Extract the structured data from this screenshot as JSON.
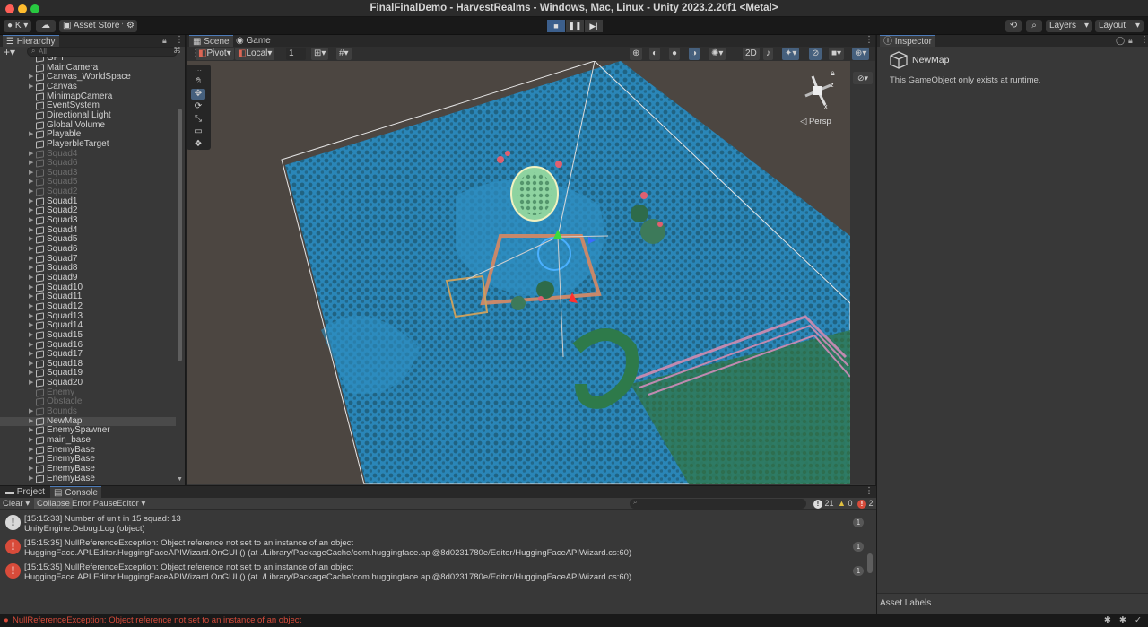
{
  "window": {
    "title": "FinalFinalDemo - HarvestRealms - Windows, Mac, Linux - Unity 2023.2.20f1 <Metal>"
  },
  "toolbar": {
    "account": "K",
    "asset_store": "Asset Store",
    "layers": "Layers",
    "layout": "Layout"
  },
  "hierarchy": {
    "tab": "Hierarchy",
    "search_placeholder": "All",
    "items": [
      {
        "label": "GPT",
        "dim": false,
        "arrow": false
      },
      {
        "label": "MainCamera",
        "dim": false,
        "arrow": false
      },
      {
        "label": "Canvas_WorldSpace",
        "dim": false,
        "arrow": true
      },
      {
        "label": "Canvas",
        "dim": false,
        "arrow": true
      },
      {
        "label": "MinimapCamera",
        "dim": false,
        "arrow": false
      },
      {
        "label": "EventSystem",
        "dim": false,
        "arrow": false
      },
      {
        "label": "Directional Light",
        "dim": false,
        "arrow": false
      },
      {
        "label": "Global Volume",
        "dim": false,
        "arrow": false
      },
      {
        "label": "Playable",
        "dim": false,
        "arrow": true
      },
      {
        "label": "PlayerbleTarget",
        "dim": false,
        "arrow": false
      },
      {
        "label": "Squad4",
        "dim": true,
        "arrow": true
      },
      {
        "label": "Squad6",
        "dim": true,
        "arrow": true
      },
      {
        "label": "Squad3",
        "dim": true,
        "arrow": true
      },
      {
        "label": "Squad5",
        "dim": true,
        "arrow": true
      },
      {
        "label": "Squad2",
        "dim": true,
        "arrow": true
      },
      {
        "label": "Squad1",
        "dim": false,
        "arrow": true
      },
      {
        "label": "Squad2",
        "dim": false,
        "arrow": true
      },
      {
        "label": "Squad3",
        "dim": false,
        "arrow": true
      },
      {
        "label": "Squad4",
        "dim": false,
        "arrow": true
      },
      {
        "label": "Squad5",
        "dim": false,
        "arrow": true
      },
      {
        "label": "Squad6",
        "dim": false,
        "arrow": true
      },
      {
        "label": "Squad7",
        "dim": false,
        "arrow": true
      },
      {
        "label": "Squad8",
        "dim": false,
        "arrow": true
      },
      {
        "label": "Squad9",
        "dim": false,
        "arrow": true
      },
      {
        "label": "Squad10",
        "dim": false,
        "arrow": true
      },
      {
        "label": "Squad11",
        "dim": false,
        "arrow": true
      },
      {
        "label": "Squad12",
        "dim": false,
        "arrow": true
      },
      {
        "label": "Squad13",
        "dim": false,
        "arrow": true
      },
      {
        "label": "Squad14",
        "dim": false,
        "arrow": true
      },
      {
        "label": "Squad15",
        "dim": false,
        "arrow": true
      },
      {
        "label": "Squad16",
        "dim": false,
        "arrow": true
      },
      {
        "label": "Squad17",
        "dim": false,
        "arrow": true
      },
      {
        "label": "Squad18",
        "dim": false,
        "arrow": true
      },
      {
        "label": "Squad19",
        "dim": false,
        "arrow": true
      },
      {
        "label": "Squad20",
        "dim": false,
        "arrow": true
      },
      {
        "label": "Enemy",
        "dim": true,
        "arrow": false
      },
      {
        "label": "Obstacle",
        "dim": true,
        "arrow": false
      },
      {
        "label": "Bounds",
        "dim": true,
        "arrow": true
      },
      {
        "label": "NewMap",
        "dim": false,
        "arrow": true,
        "selected": true
      },
      {
        "label": "EnemySpawner",
        "dim": false,
        "arrow": true
      },
      {
        "label": "main_base",
        "dim": false,
        "arrow": true
      },
      {
        "label": "EnemyBase",
        "dim": false,
        "arrow": true
      },
      {
        "label": "EnemyBase",
        "dim": false,
        "arrow": true
      },
      {
        "label": "EnemyBase",
        "dim": false,
        "arrow": true
      },
      {
        "label": "EnemyBase",
        "dim": false,
        "arrow": true
      }
    ]
  },
  "scene": {
    "tab_scene": "Scene",
    "tab_game": "Game",
    "pivot": "Pivot",
    "local": "Local",
    "grid_snap": "1",
    "mode_2d": "2D",
    "persp": "Persp"
  },
  "inspector": {
    "tab": "Inspector",
    "object_name": "NewMap",
    "message": "This GameObject only exists at runtime.",
    "asset_labels": "Asset Labels"
  },
  "console": {
    "tab_project": "Project",
    "tab_console": "Console",
    "clear": "Clear",
    "collapse": "Collapse",
    "error_pause": "Error Pause",
    "editor": "Editor",
    "count_info": "21",
    "count_warn": "0",
    "count_error": "2",
    "entries": [
      {
        "type": "info",
        "line1": "[15:15:33] Number of unit in 15 squad: 13",
        "line2": "UnityEngine.Debug:Log (object)",
        "count": "1"
      },
      {
        "type": "error",
        "line1": "[15:15:35] NullReferenceException: Object reference not set to an instance of an object",
        "line2": "HuggingFace.API.Editor.HuggingFaceAPIWizard.OnGUI () (at ./Library/PackageCache/com.huggingface.api@8d0231780e/Editor/HuggingFaceAPIWizard.cs:60)",
        "count": "1"
      },
      {
        "type": "error",
        "line1": "[15:15:35] NullReferenceException: Object reference not set to an instance of an object",
        "line2": "HuggingFace.API.Editor.HuggingFaceAPIWizard.OnGUI () (at ./Library/PackageCache/com.huggingface.api@8d0231780e/Editor/HuggingFaceAPIWizard.cs:60)",
        "count": "1"
      }
    ]
  },
  "statusbar": {
    "message": "NullReferenceException: Object reference not set to an instance of an object"
  },
  "colors": {
    "accent": "#3c5f8c",
    "error": "#d84b3a",
    "water": "#2a86b8"
  }
}
